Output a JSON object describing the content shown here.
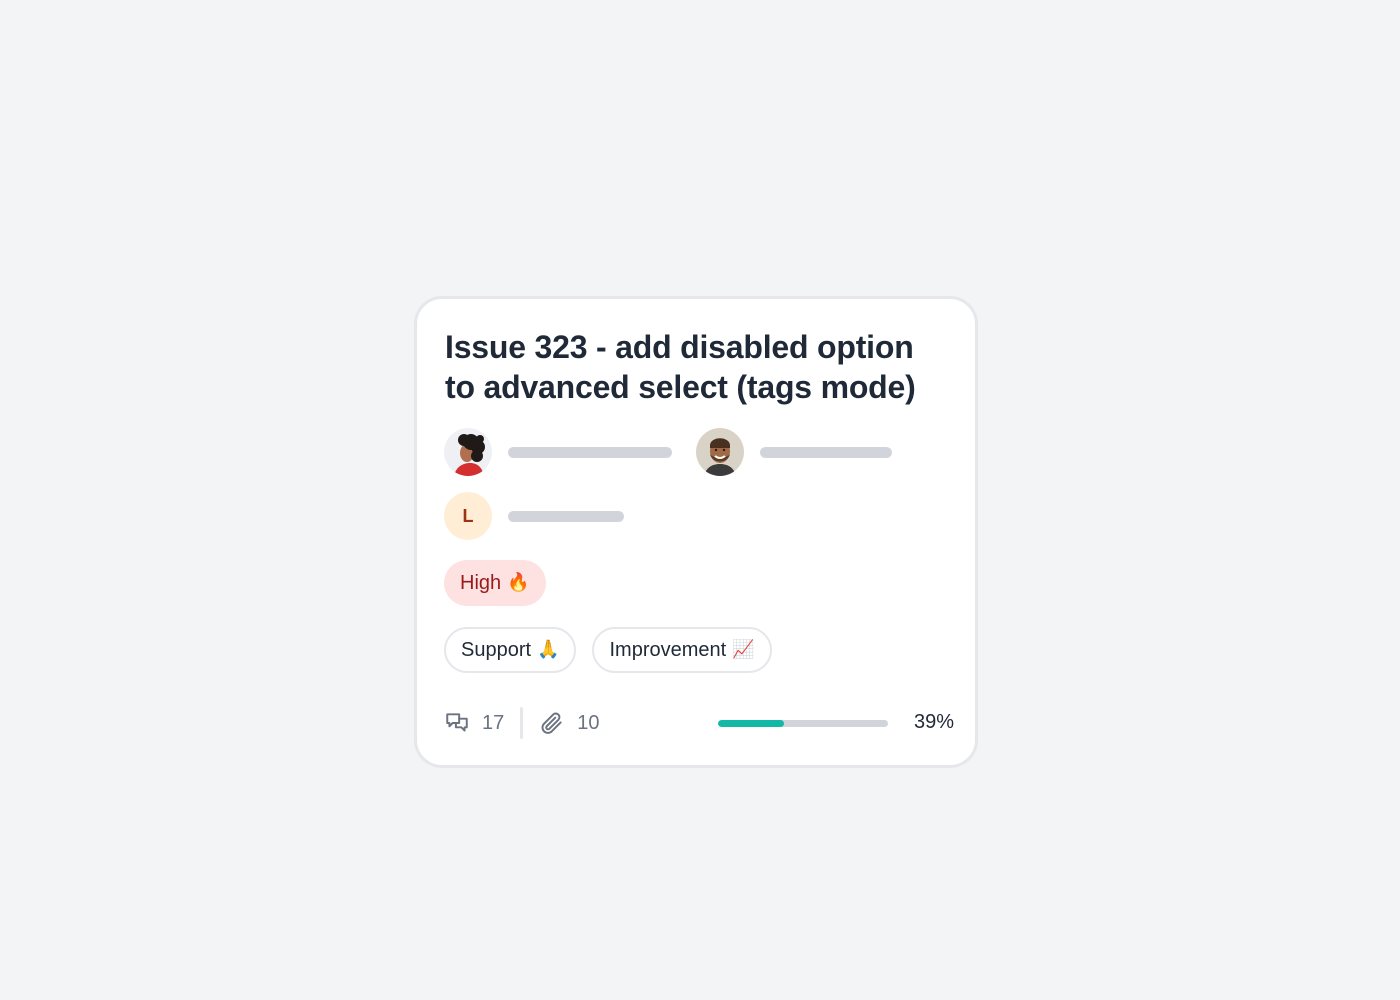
{
  "card": {
    "title": "Issue 323 - add disabled option to advanced select (tags mode)",
    "assignees": [
      {
        "type": "photo",
        "avatar_icon": "curly-hair-person-avatar"
      },
      {
        "type": "photo",
        "avatar_icon": "smiling-bearded-person-avatar"
      },
      {
        "type": "initial",
        "initial": "L"
      }
    ],
    "priority": {
      "label": "High",
      "emoji": "🔥"
    },
    "tags": [
      {
        "label": "Support",
        "emoji": "🙏"
      },
      {
        "label": "Improvement",
        "emoji": "📈"
      }
    ],
    "footer": {
      "comments_count": "17",
      "attachments_count": "10",
      "progress_fraction": 0.39,
      "progress_label": "39%"
    }
  },
  "colors": {
    "background": "#f3f4f6",
    "card_border": "#e5e7eb",
    "title": "#1f2937",
    "priority_bg": "#fee2e2",
    "priority_text": "#991b1b",
    "avatar_initial_bg": "#ffedd5",
    "avatar_initial_text": "#9a3412",
    "progress_fill": "#14b8a6",
    "progress_track": "#d1d5db"
  }
}
